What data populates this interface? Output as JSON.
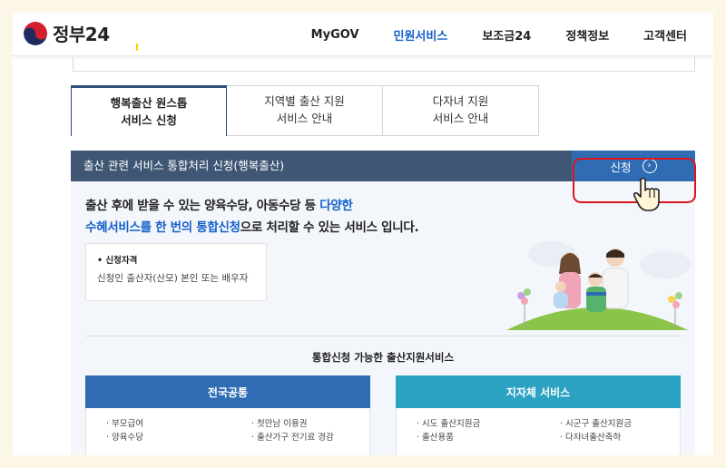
{
  "header": {
    "logo_text": "정부24",
    "nav": [
      "MyGOV",
      "민원서비스",
      "보조금24",
      "정책정보",
      "고객센터"
    ],
    "active_nav": "민원서비스"
  },
  "tabs": [
    {
      "label": "행복출산 원스톱\n서비스 신청",
      "active": true
    },
    {
      "label": "지역별 출산 지원\n서비스 안내",
      "active": false
    },
    {
      "label": "다자녀 지원\n서비스 안내",
      "active": false
    }
  ],
  "panel": {
    "title": "출산 관련 서비스 통합처리 신청(행복출산)",
    "apply_label": "신청",
    "desc_line1_a": "출산 후에 받을 수 있는 양육수당, 아동수당 등 ",
    "desc_line1_b": "다양한",
    "desc_line2_a": "수혜서비스를 한 번의 통합신청",
    "desc_line2_b": "으로 처리할 수 있는 서비스 입니다.",
    "qualification_title": "신청자격",
    "qualification_text": "신청인 출산자(산모) 본인 또는 배우자"
  },
  "services": {
    "title": "통합신청 가능한 출산지원서비스",
    "national": {
      "label": "전국공통",
      "left": [
        "부모급여",
        "양육수당"
      ],
      "right": [
        "첫만남 이용권",
        "출산가구 전기료 경감"
      ]
    },
    "local": {
      "label": "지자체 서비스",
      "left": [
        "시도 출산지원금",
        "출산용품"
      ],
      "right": [
        "시군구 출산지원금",
        "다자녀출산축하"
      ]
    }
  },
  "colors": {
    "brand_blue": "#1460c9",
    "panel_bar": "#3f5775",
    "apply_button": "#2f6cb3",
    "national_head": "#2f6cb3",
    "local_head": "#2ca2c3",
    "highlight_box": "#e1131a"
  }
}
